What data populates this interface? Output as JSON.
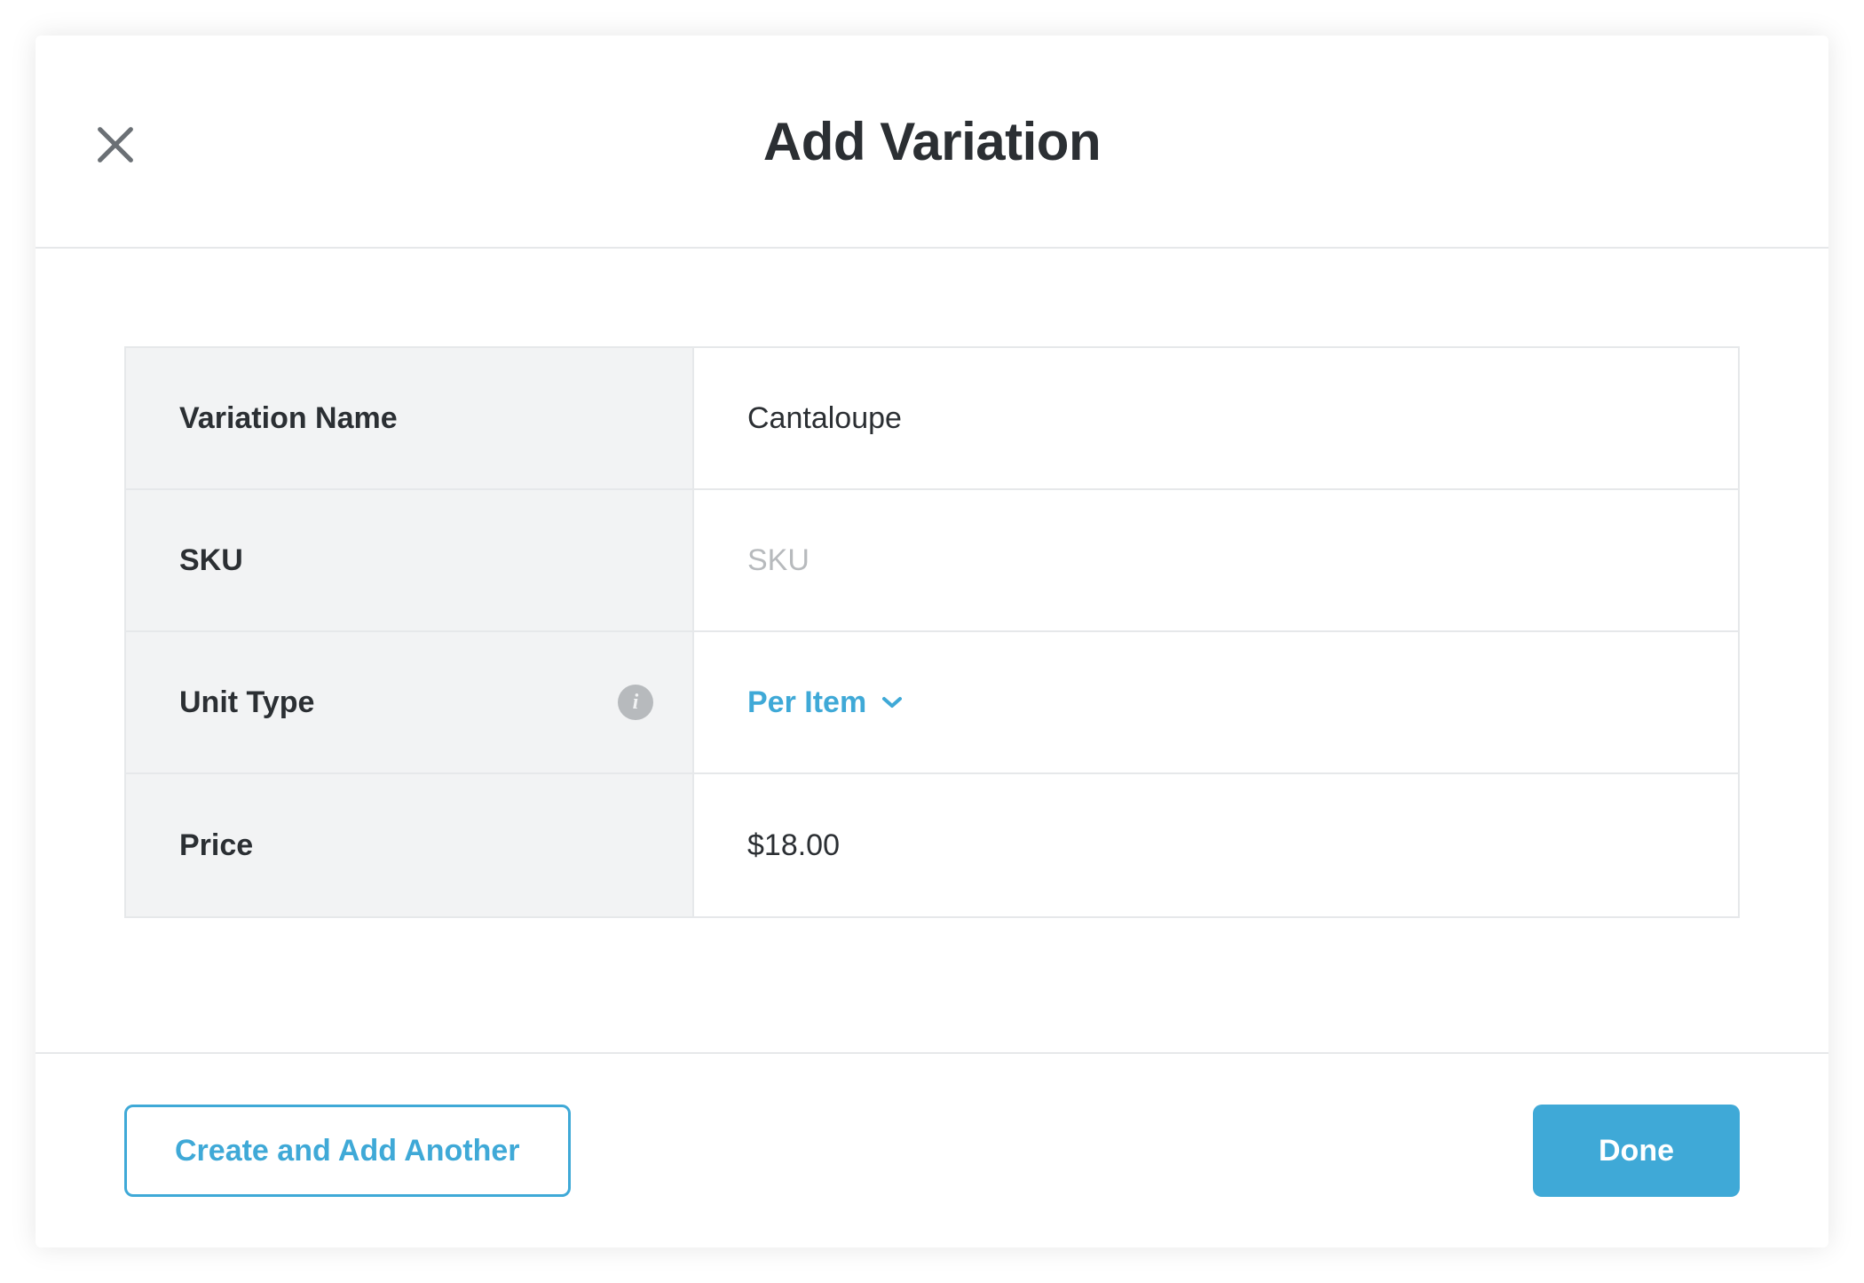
{
  "header": {
    "title": "Add Variation"
  },
  "form": {
    "variation_name": {
      "label": "Variation Name",
      "value": "Cantaloupe"
    },
    "sku": {
      "label": "SKU",
      "value": "",
      "placeholder": "SKU"
    },
    "unit_type": {
      "label": "Unit Type",
      "selected": "Per Item"
    },
    "price": {
      "label": "Price",
      "value": "$18.00"
    }
  },
  "footer": {
    "create_another_label": "Create and Add Another",
    "done_label": "Done"
  },
  "colors": {
    "accent": "#3fa9d7",
    "text": "#2b2f33",
    "label_bg": "#f2f3f4",
    "border": "#e6e8ea",
    "muted": "#b7babd"
  }
}
